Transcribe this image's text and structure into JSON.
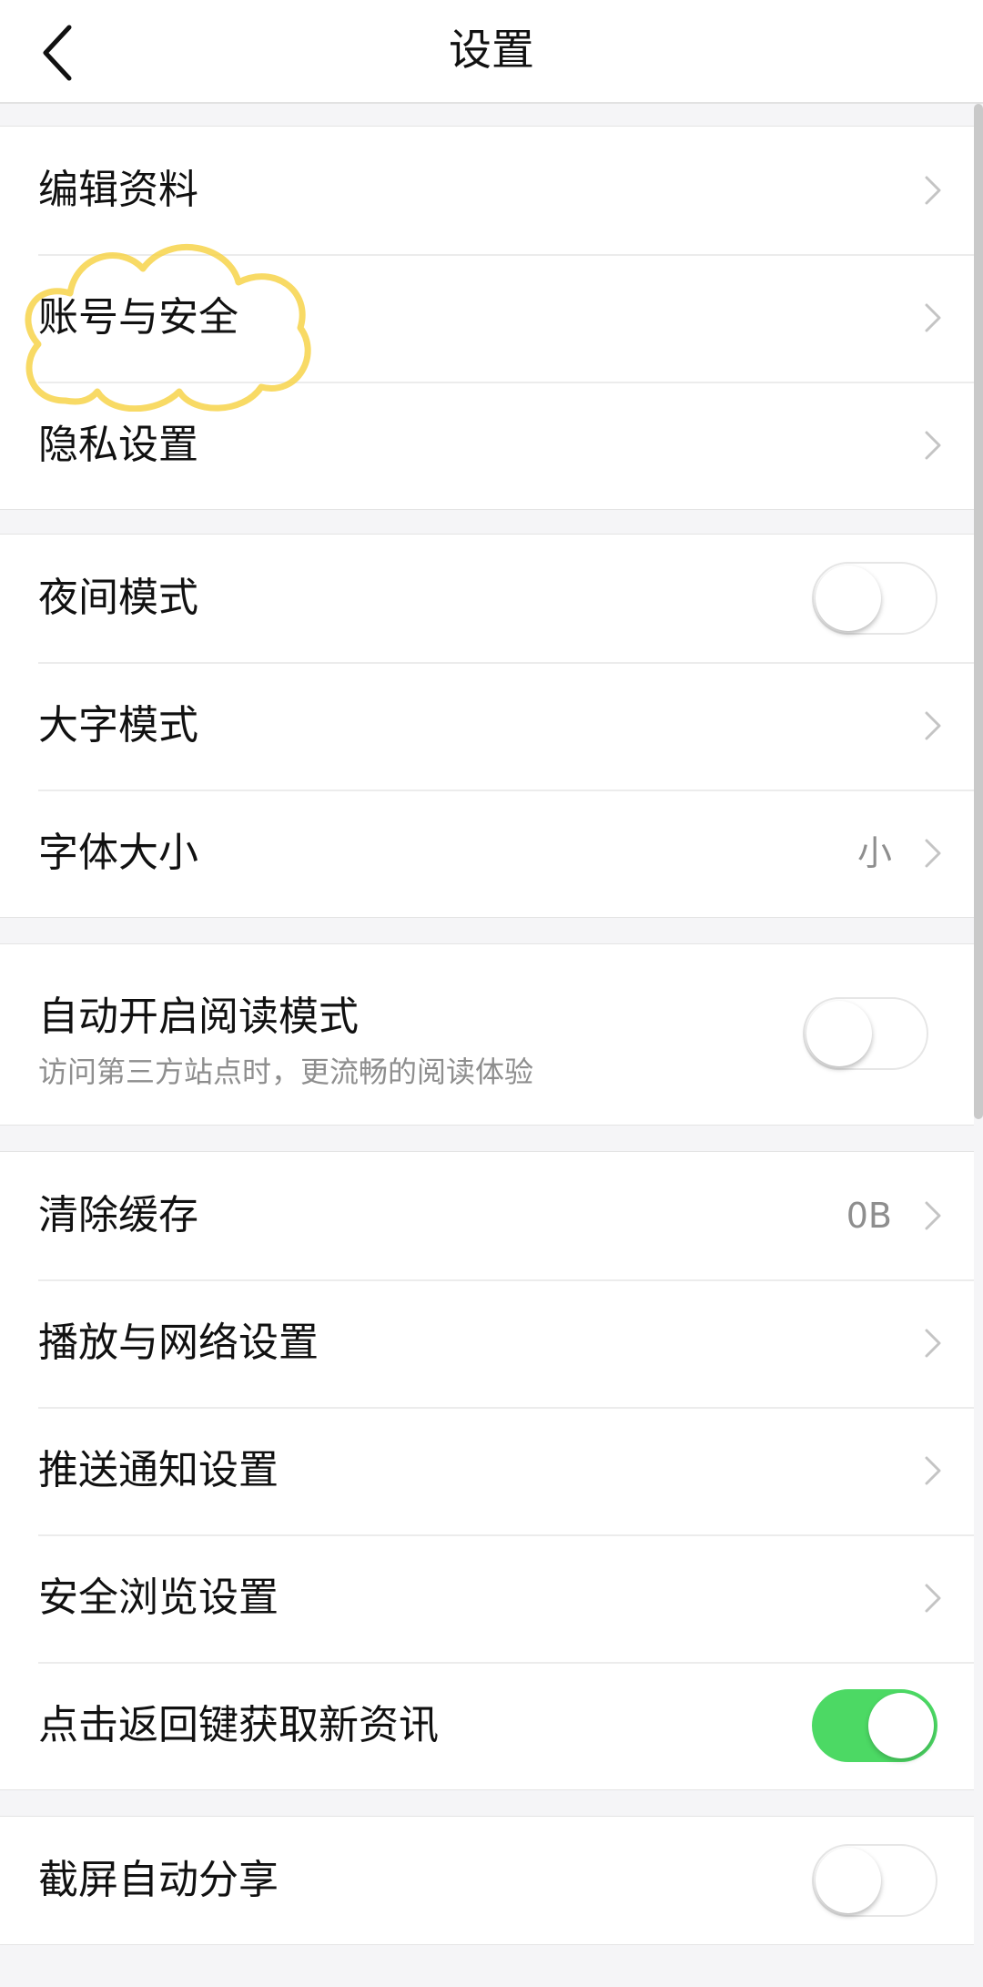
{
  "header": {
    "title": "设置",
    "back_icon": "chevron-left-icon"
  },
  "groups": [
    {
      "id": "profile",
      "rows": [
        {
          "label": "编辑资料",
          "control": "chevron"
        },
        {
          "label": "账号与安全",
          "control": "chevron"
        },
        {
          "label": "隐私设置",
          "control": "chevron"
        }
      ]
    },
    {
      "id": "display",
      "rows": [
        {
          "label": "夜间模式",
          "control": "toggle",
          "on": false
        },
        {
          "label": "大字模式",
          "control": "chevron"
        },
        {
          "label": "字体大小",
          "value": "小",
          "control": "chevron"
        }
      ]
    },
    {
      "id": "reading",
      "rows": [
        {
          "label": "自动开启阅读模式",
          "sublabel": "访问第三方站点时，更流畅的阅读体验",
          "control": "toggle",
          "on": false
        }
      ]
    },
    {
      "id": "general",
      "rows": [
        {
          "label": "清除缓存",
          "value": "0B",
          "control": "chevron"
        },
        {
          "label": "播放与网络设置",
          "control": "chevron"
        },
        {
          "label": "推送通知设置",
          "control": "chevron"
        },
        {
          "label": "安全浏览设置",
          "control": "chevron"
        },
        {
          "label": "点击返回键获取新资讯",
          "control": "toggle",
          "on": true
        }
      ]
    },
    {
      "id": "share",
      "rows": [
        {
          "label": "截屏自动分享",
          "control": "toggle",
          "on": false
        }
      ]
    }
  ],
  "colors": {
    "toggle_on": "#4cd964",
    "background": "#f5f5f7",
    "highlight_annotation": "#f7d34a"
  },
  "annotation": {
    "shape": "cloud-highlight",
    "target": "账号与安全"
  }
}
